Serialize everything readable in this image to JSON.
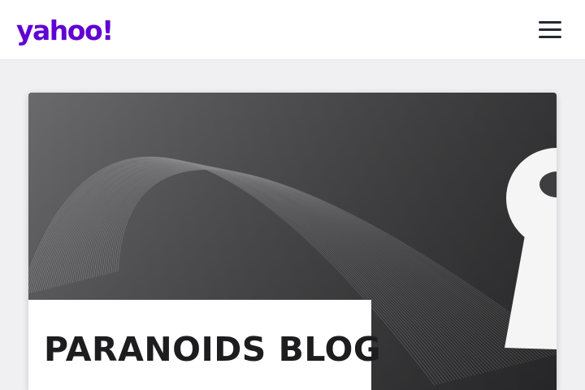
{
  "header": {
    "logo_text": "yahoo!",
    "brand_color": "#6001d2",
    "menu_icon": "hamburger-menu-icon"
  },
  "hero": {
    "blog_title": "PARANOIDS BLOG",
    "art_icon": "keyhole-icon"
  }
}
